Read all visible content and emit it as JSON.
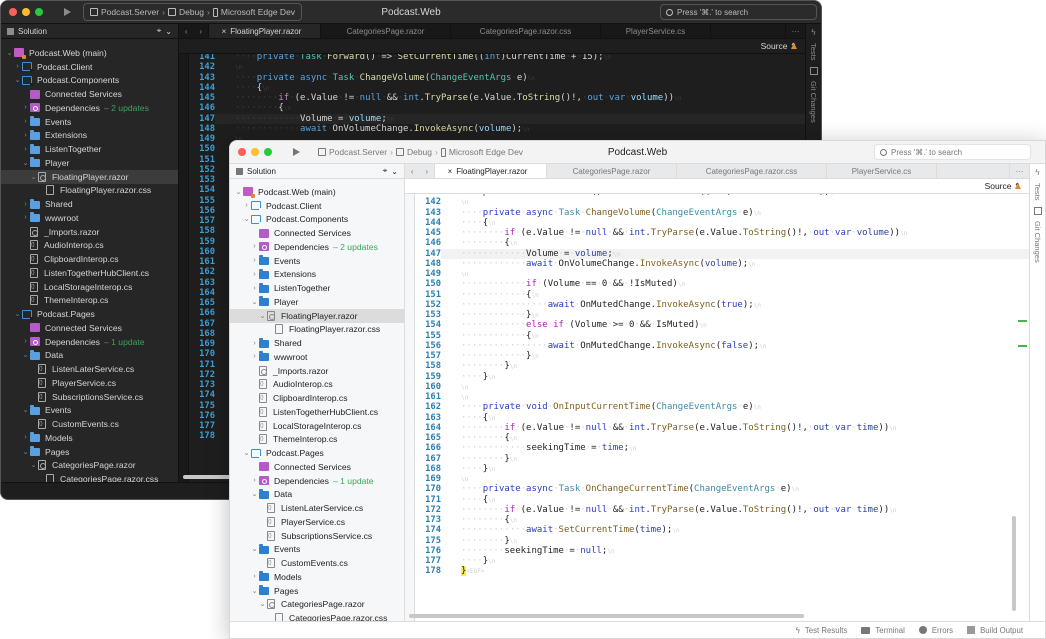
{
  "app": {
    "title": "Podcast.Web",
    "run_target": [
      "Podcast.Server",
      "Debug",
      "Microsoft Edge Dev"
    ],
    "search_placeholder": "Press '⌘.' to search"
  },
  "sidebar": {
    "title": "Solution"
  },
  "tabs": [
    {
      "label": "FloatingPlayer.razor",
      "active": true
    },
    {
      "label": "CategoriesPage.razor",
      "active": false
    },
    {
      "label": "CategoriesPage.razor.css",
      "active": false
    },
    {
      "label": "PlayerService.cs",
      "active": false
    }
  ],
  "editor": {
    "view_mode": "Source",
    "current_line": 147,
    "lines": [
      {
        "n": 141,
        "indent": 4,
        "code": "private Task Forward() => SetCurrentTime((int)CurrentTime + 15);"
      },
      {
        "n": 142,
        "indent": 0,
        "code": ""
      },
      {
        "n": 143,
        "indent": 4,
        "code": "private async Task ChangeVolume(ChangeEventArgs e)"
      },
      {
        "n": 144,
        "indent": 4,
        "code": "{"
      },
      {
        "n": 145,
        "indent": 8,
        "code": "if (e.Value != null && int.TryParse(e.Value.ToString()!, out var volume))"
      },
      {
        "n": 146,
        "indent": 8,
        "code": "{"
      },
      {
        "n": 147,
        "indent": 12,
        "code": "Volume = volume;"
      },
      {
        "n": 148,
        "indent": 12,
        "code": "await OnVolumeChange.InvokeAsync(volume);"
      },
      {
        "n": 149,
        "indent": 0,
        "code": ""
      },
      {
        "n": 150,
        "indent": 12,
        "code": "if (Volume == 0 && !IsMuted)"
      },
      {
        "n": 151,
        "indent": 12,
        "code": "{"
      },
      {
        "n": 152,
        "indent": 16,
        "code": "await OnMutedChange.InvokeAsync(true);"
      },
      {
        "n": 153,
        "indent": 12,
        "code": "}"
      },
      {
        "n": 154,
        "indent": 12,
        "code": "else if (Volume >= 0 && IsMuted)"
      },
      {
        "n": 155,
        "indent": 12,
        "code": "{"
      },
      {
        "n": 156,
        "indent": 16,
        "code": "await OnMutedChange.InvokeAsync(false);"
      },
      {
        "n": 157,
        "indent": 12,
        "code": "}"
      },
      {
        "n": 158,
        "indent": 8,
        "code": "}"
      },
      {
        "n": 159,
        "indent": 4,
        "code": "}"
      },
      {
        "n": 160,
        "indent": 0,
        "code": ""
      },
      {
        "n": 161,
        "indent": 0,
        "code": ""
      },
      {
        "n": 162,
        "indent": 4,
        "code": "private void OnInputCurrentTime(ChangeEventArgs e)"
      },
      {
        "n": 163,
        "indent": 4,
        "code": "{"
      },
      {
        "n": 164,
        "indent": 8,
        "code": "if (e.Value != null && int.TryParse(e.Value.ToString()!, out var time))"
      },
      {
        "n": 165,
        "indent": 8,
        "code": "{"
      },
      {
        "n": 166,
        "indent": 12,
        "code": "seekingTime = time;"
      },
      {
        "n": 167,
        "indent": 8,
        "code": "}"
      },
      {
        "n": 168,
        "indent": 4,
        "code": "}"
      },
      {
        "n": 169,
        "indent": 0,
        "code": ""
      },
      {
        "n": 170,
        "indent": 4,
        "code": "private async Task OnChangeCurrentTime(ChangeEventArgs e)"
      },
      {
        "n": 171,
        "indent": 4,
        "code": "{"
      },
      {
        "n": 172,
        "indent": 8,
        "code": "if (e.Value != null && int.TryParse(e.Value.ToString()!, out var time))"
      },
      {
        "n": 173,
        "indent": 8,
        "code": "{"
      },
      {
        "n": 174,
        "indent": 12,
        "code": "await SetCurrentTime(time);"
      },
      {
        "n": 175,
        "indent": 8,
        "code": "}"
      },
      {
        "n": 176,
        "indent": 8,
        "code": "seekingTime = null;"
      },
      {
        "n": 177,
        "indent": 4,
        "code": "}"
      },
      {
        "n": 178,
        "indent": 0,
        "code": "}"
      }
    ]
  },
  "tree": [
    {
      "label": "Podcast.Web (main)",
      "depth": 0,
      "icon": "web",
      "state": "open"
    },
    {
      "label": "Podcast.Client",
      "depth": 1,
      "icon": "project",
      "state": "closed"
    },
    {
      "label": "Podcast.Components",
      "depth": 1,
      "icon": "project",
      "state": "open"
    },
    {
      "label": "Connected Services",
      "depth": 2,
      "icon": "connected",
      "state": "leaf"
    },
    {
      "label": "Dependencies",
      "depth": 2,
      "icon": "deps",
      "state": "closed",
      "badge": "– 2 updates"
    },
    {
      "label": "Events",
      "depth": 2,
      "icon": "folder",
      "state": "closed"
    },
    {
      "label": "Extensions",
      "depth": 2,
      "icon": "folder",
      "state": "closed"
    },
    {
      "label": "ListenTogether",
      "depth": 2,
      "icon": "folder",
      "state": "closed"
    },
    {
      "label": "Player",
      "depth": 2,
      "icon": "folder",
      "state": "open"
    },
    {
      "label": "FloatingPlayer.razor",
      "depth": 3,
      "icon": "razor",
      "state": "open",
      "selected": true
    },
    {
      "label": "FloatingPlayer.razor.css",
      "depth": 4,
      "icon": "css",
      "state": "leaf"
    },
    {
      "label": "Shared",
      "depth": 2,
      "icon": "folder",
      "state": "closed"
    },
    {
      "label": "wwwroot",
      "depth": 2,
      "icon": "folder",
      "state": "closed"
    },
    {
      "label": "_Imports.razor",
      "depth": 2,
      "icon": "razor",
      "state": "leaf"
    },
    {
      "label": "AudioInterop.cs",
      "depth": 2,
      "icon": "cs",
      "state": "leaf"
    },
    {
      "label": "ClipboardInterop.cs",
      "depth": 2,
      "icon": "cs",
      "state": "leaf"
    },
    {
      "label": "ListenTogetherHubClient.cs",
      "depth": 2,
      "icon": "cs",
      "state": "leaf"
    },
    {
      "label": "LocalStorageInterop.cs",
      "depth": 2,
      "icon": "cs",
      "state": "leaf"
    },
    {
      "label": "ThemeInterop.cs",
      "depth": 2,
      "icon": "cs",
      "state": "leaf"
    },
    {
      "label": "Podcast.Pages",
      "depth": 1,
      "icon": "project",
      "state": "open"
    },
    {
      "label": "Connected Services",
      "depth": 2,
      "icon": "connected",
      "state": "leaf"
    },
    {
      "label": "Dependencies",
      "depth": 2,
      "icon": "deps",
      "state": "closed",
      "badge": "– 1 update"
    },
    {
      "label": "Data",
      "depth": 2,
      "icon": "folder",
      "state": "open"
    },
    {
      "label": "ListenLaterService.cs",
      "depth": 3,
      "icon": "cs",
      "state": "leaf"
    },
    {
      "label": "PlayerService.cs",
      "depth": 3,
      "icon": "cs",
      "state": "leaf"
    },
    {
      "label": "SubscriptionsService.cs",
      "depth": 3,
      "icon": "cs",
      "state": "leaf"
    },
    {
      "label": "Events",
      "depth": 2,
      "icon": "folder",
      "state": "open"
    },
    {
      "label": "CustomEvents.cs",
      "depth": 3,
      "icon": "cs",
      "state": "leaf"
    },
    {
      "label": "Models",
      "depth": 2,
      "icon": "folder",
      "state": "closed"
    },
    {
      "label": "Pages",
      "depth": 2,
      "icon": "folder",
      "state": "open"
    },
    {
      "label": "CategoriesPage.razor",
      "depth": 3,
      "icon": "razor",
      "state": "open"
    },
    {
      "label": "CategoriesPage.razor.css",
      "depth": 4,
      "icon": "css",
      "state": "leaf"
    }
  ],
  "right_panel": {
    "tests": "Tests",
    "git_changes": "Git Changes"
  },
  "status_bar": {
    "test_results": "Test Results",
    "terminal": "Terminal",
    "errors": "Errors",
    "build_output": "Build Output"
  },
  "colors": {
    "update_badge": "#3aa55a",
    "warning": "#e08a2c",
    "change_marker": "#4caf50",
    "eof_highlight": "#ffe94a"
  }
}
